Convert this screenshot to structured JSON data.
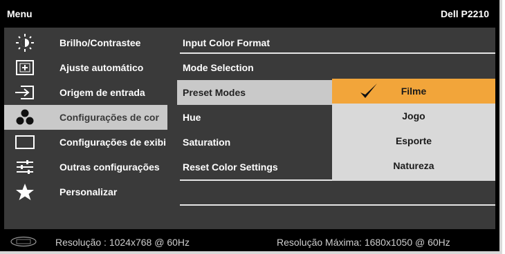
{
  "header": {
    "title": "Menu",
    "model": "Dell P2210"
  },
  "sidebar": {
    "items": [
      {
        "label": "Brilho/Contrastee",
        "icon": "brightness-icon"
      },
      {
        "label": "Ajuste automático",
        "icon": "auto-adjust-icon"
      },
      {
        "label": "Origem de entrada",
        "icon": "input-source-icon"
      },
      {
        "label": "Configurações de cor",
        "icon": "color-settings-icon",
        "selected": true
      },
      {
        "label": "Configurações de exibi",
        "icon": "display-settings-icon"
      },
      {
        "label": "Outras configurações",
        "icon": "other-settings-icon"
      },
      {
        "label": "Personalizar",
        "icon": "star-icon"
      }
    ]
  },
  "color_menu": {
    "items": [
      {
        "label": "Input Color Format"
      },
      {
        "label": "Mode Selection"
      },
      {
        "label": "Preset Modes",
        "selected": true
      },
      {
        "label": "Hue"
      },
      {
        "label": "Saturation"
      },
      {
        "label": "Reset Color Settings"
      }
    ]
  },
  "preset_modes": {
    "options": [
      {
        "label": "Filme",
        "selected": true
      },
      {
        "label": "Jogo"
      },
      {
        "label": "Esporte"
      },
      {
        "label": "Natureza"
      }
    ]
  },
  "footer": {
    "resolution": "Resolução : 1024x768 @ 60Hz",
    "max_resolution": "Resolução Máxima: 1680x1050 @ 60Hz",
    "logo": "dell-logo"
  },
  "colors": {
    "background": "#000000",
    "panel": "#3a3a3a",
    "selected_gray": "#c9c9c9",
    "selected_orange": "#f2a53a",
    "submenu_bg": "#d9d9d9"
  }
}
